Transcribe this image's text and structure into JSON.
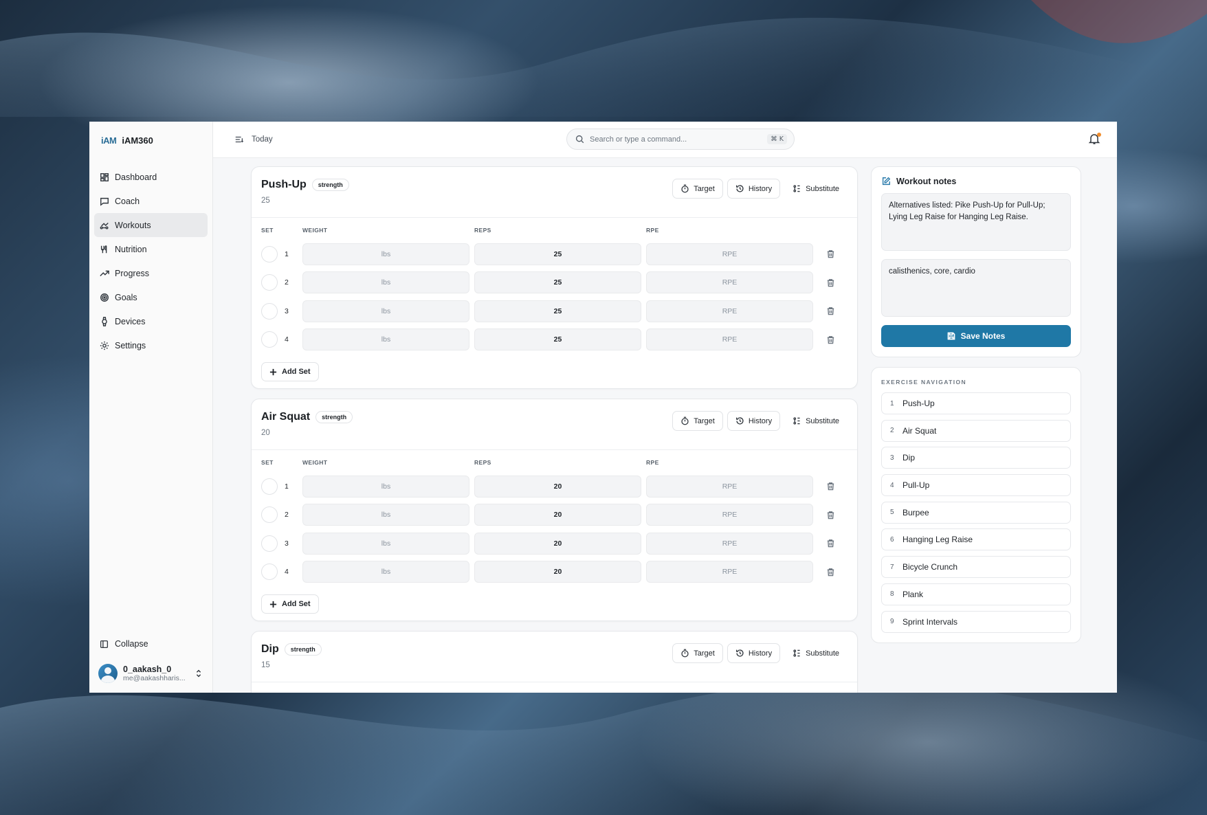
{
  "brand": {
    "logo": "iAM",
    "name": "iAM360"
  },
  "sidebar": {
    "items": [
      {
        "label": "Dashboard",
        "icon": "dashboard-icon"
      },
      {
        "label": "Coach",
        "icon": "chat-icon"
      },
      {
        "label": "Workouts",
        "icon": "workouts-icon",
        "active": true
      },
      {
        "label": "Nutrition",
        "icon": "utensils-icon"
      },
      {
        "label": "Progress",
        "icon": "trend-icon"
      },
      {
        "label": "Goals",
        "icon": "target-icon"
      },
      {
        "label": "Devices",
        "icon": "watch-icon"
      },
      {
        "label": "Settings",
        "icon": "gear-icon"
      }
    ],
    "collapse_label": "Collapse",
    "user": {
      "name": "0_aakash_0",
      "email": "me@aakashharis..."
    }
  },
  "topbar": {
    "date_label": "Today",
    "search_placeholder": "Search or type a command...",
    "shortcut": "⌘ K"
  },
  "columns": {
    "set": "SET",
    "weight": "WEIGHT",
    "reps": "REPS",
    "rpe": "RPE"
  },
  "field_placeholders": {
    "weight": "lbs",
    "rpe": "RPE"
  },
  "buttons": {
    "target": "Target",
    "history": "History",
    "substitute": "Substitute",
    "add_set": "Add Set"
  },
  "exercises": [
    {
      "name": "Push-Up",
      "type": "strength",
      "subtitle": "25",
      "sets": [
        {
          "n": "1",
          "reps": "25"
        },
        {
          "n": "2",
          "reps": "25"
        },
        {
          "n": "3",
          "reps": "25"
        },
        {
          "n": "4",
          "reps": "25"
        }
      ]
    },
    {
      "name": "Air Squat",
      "type": "strength",
      "subtitle": "20",
      "sets": [
        {
          "n": "1",
          "reps": "20"
        },
        {
          "n": "2",
          "reps": "20"
        },
        {
          "n": "3",
          "reps": "20"
        },
        {
          "n": "4",
          "reps": "20"
        }
      ]
    },
    {
      "name": "Dip",
      "type": "strength",
      "subtitle": "15",
      "sets": []
    }
  ],
  "notes": {
    "title": "Workout notes",
    "note1": "Alternatives listed: Pike Push-Up for Pull-Up; Lying Leg Raise for Hanging Leg Raise.",
    "note2": "calisthenics, core, cardio",
    "save_label": "Save Notes"
  },
  "exercise_nav": {
    "label": "EXERCISE NAVIGATION",
    "items": [
      {
        "num": "1",
        "name": "Push-Up"
      },
      {
        "num": "2",
        "name": "Air Squat"
      },
      {
        "num": "3",
        "name": "Dip"
      },
      {
        "num": "4",
        "name": "Pull-Up"
      },
      {
        "num": "5",
        "name": "Burpee"
      },
      {
        "num": "6",
        "name": "Hanging Leg Raise"
      },
      {
        "num": "7",
        "name": "Bicycle Crunch"
      },
      {
        "num": "8",
        "name": "Plank"
      },
      {
        "num": "9",
        "name": "Sprint Intervals"
      }
    ]
  },
  "colors": {
    "accent": "#1f78a6",
    "notification_dot": "#f08c2b"
  }
}
